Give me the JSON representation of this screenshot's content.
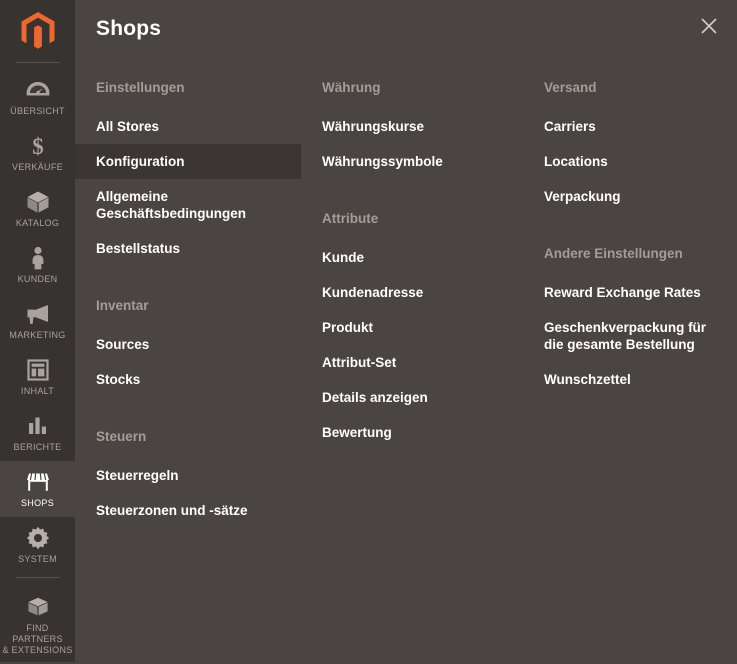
{
  "sidebar": {
    "logo": "magento-logo-icon",
    "items": [
      {
        "id": "uebersicht",
        "label": "ÜBERSICHT",
        "icon": "dashboard-gauge-icon",
        "active": false
      },
      {
        "id": "verkaeufe",
        "label": "VERKÄUFE",
        "icon": "dollar-sign-icon",
        "active": false
      },
      {
        "id": "katalog",
        "label": "KATALOG",
        "icon": "box-icon",
        "active": false
      },
      {
        "id": "kunden",
        "label": "KUNDEN",
        "icon": "person-icon",
        "active": false
      },
      {
        "id": "marketing",
        "label": "MARKETING",
        "icon": "megaphone-icon",
        "active": false
      },
      {
        "id": "inhalt",
        "label": "INHALT",
        "icon": "page-layout-icon",
        "active": false
      },
      {
        "id": "berichte",
        "label": "BERICHTE",
        "icon": "bar-chart-icon",
        "active": false
      },
      {
        "id": "shops",
        "label": "SHOPS",
        "icon": "storefront-icon",
        "active": true
      },
      {
        "id": "system",
        "label": "SYSTEM",
        "icon": "gear-icon",
        "active": false
      },
      {
        "id": "find-partners",
        "label": "FIND PARTNERS\n& EXTENSIONS",
        "icon": "cube-icon",
        "active": false
      }
    ]
  },
  "header": {
    "title": "Shops",
    "close_label": "×"
  },
  "columns": [
    {
      "id": "column-1",
      "groups": [
        {
          "id": "einstellungen",
          "title": "Einstellungen",
          "items": [
            {
              "id": "all-stores",
              "label": "All Stores",
              "active": false
            },
            {
              "id": "konfiguration",
              "label": "Konfiguration",
              "active": true
            },
            {
              "id": "agb",
              "label": "Allgemeine Geschäftsbedingungen",
              "active": false
            },
            {
              "id": "bestellstatus",
              "label": "Bestellstatus",
              "active": false
            }
          ]
        },
        {
          "id": "inventar",
          "title": "Inventar",
          "items": [
            {
              "id": "sources",
              "label": "Sources",
              "active": false
            },
            {
              "id": "stocks",
              "label": "Stocks",
              "active": false
            }
          ]
        },
        {
          "id": "steuern",
          "title": "Steuern",
          "items": [
            {
              "id": "steuerregeln",
              "label": "Steuerregeln",
              "active": false
            },
            {
              "id": "steuerzonen",
              "label": "Steuerzonen und -sätze",
              "active": false
            }
          ]
        }
      ]
    },
    {
      "id": "column-2",
      "groups": [
        {
          "id": "waehrung",
          "title": "Währung",
          "items": [
            {
              "id": "waehrungskurse",
              "label": "Währungskurse",
              "active": false
            },
            {
              "id": "waehrungssymbole",
              "label": "Währungssymbole",
              "active": false
            }
          ]
        },
        {
          "id": "attribute",
          "title": "Attribute",
          "items": [
            {
              "id": "kunde",
              "label": "Kunde",
              "active": false
            },
            {
              "id": "kundenadresse",
              "label": "Kundenadresse",
              "active": false
            },
            {
              "id": "produkt",
              "label": "Produkt",
              "active": false
            },
            {
              "id": "attribut-set",
              "label": "Attribut-Set",
              "active": false
            },
            {
              "id": "details-anzeigen",
              "label": "Details anzeigen",
              "active": false
            },
            {
              "id": "bewertung",
              "label": "Bewertung",
              "active": false
            }
          ]
        }
      ]
    },
    {
      "id": "column-3",
      "groups": [
        {
          "id": "versand",
          "title": "Versand",
          "items": [
            {
              "id": "carriers",
              "label": "Carriers",
              "active": false
            },
            {
              "id": "locations",
              "label": "Locations",
              "active": false
            },
            {
              "id": "verpackung",
              "label": "Verpackung",
              "active": false
            }
          ]
        },
        {
          "id": "andere-einstellungen",
          "title": "Andere Einstellungen",
          "items": [
            {
              "id": "reward-exchange-rates",
              "label": "Reward Exchange Rates",
              "active": false
            },
            {
              "id": "geschenkverpackung",
              "label": "Geschenkverpackung für die gesamte Bestellung",
              "active": false
            },
            {
              "id": "wunschzettel",
              "label": "Wunschzettel",
              "active": false
            }
          ]
        }
      ]
    }
  ],
  "colors": {
    "sidebar_bg": "#373330",
    "panel_bg": "#4a4542",
    "accent_orange": "#ee672e",
    "active_item_bg": "#3b3633",
    "group_title": "#a59c95",
    "link_text": "#ffffff",
    "nav_label": "#a9a29d"
  },
  "layout": {
    "group_offsets": {
      "col1": [
        80,
        324,
        480
      ],
      "col2": [
        80,
        236
      ],
      "col3": [
        80,
        272
      ]
    }
  }
}
